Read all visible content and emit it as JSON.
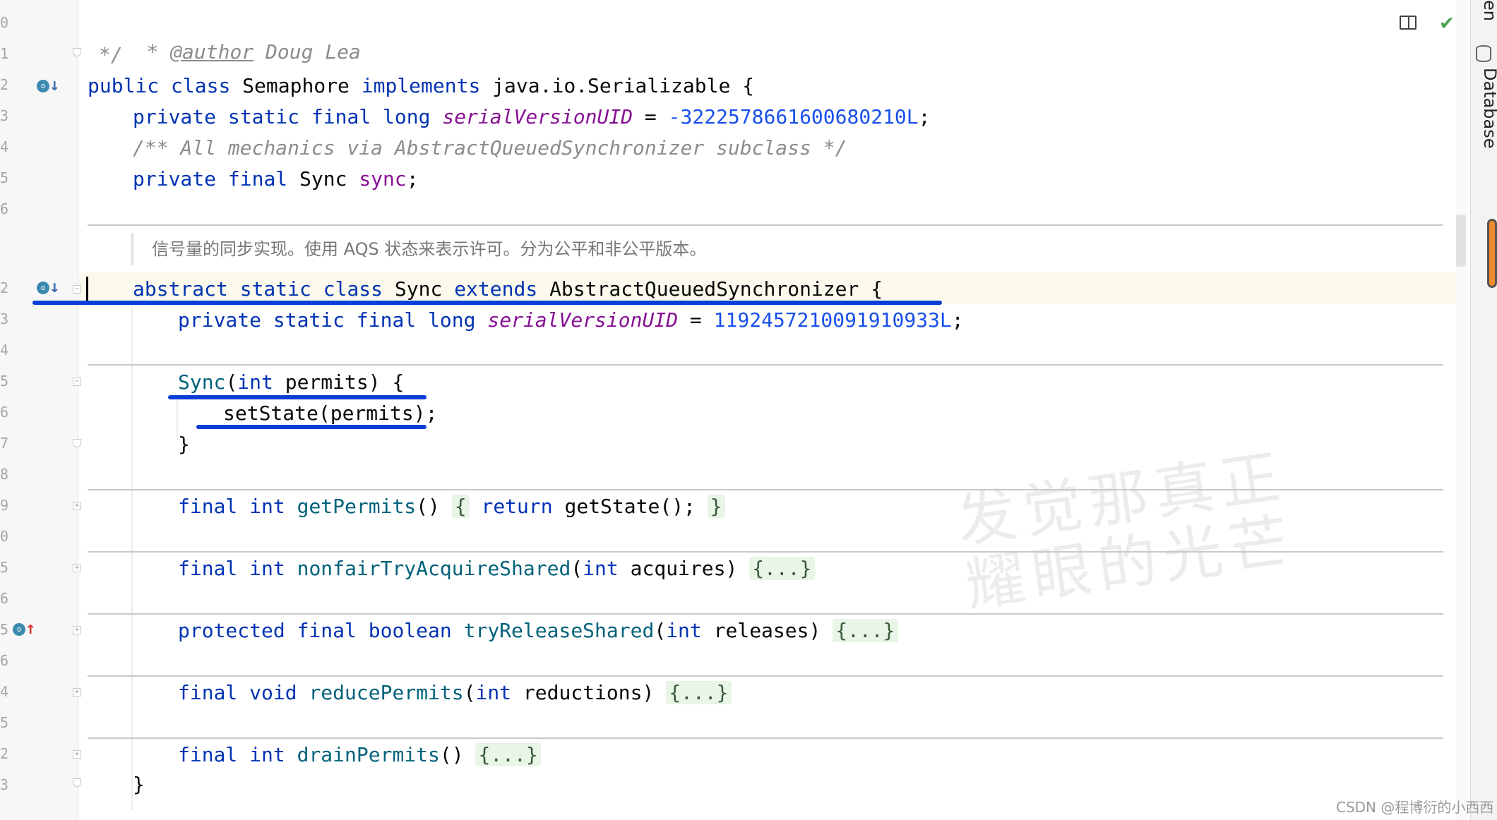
{
  "gutter": {
    "line_numbers": [
      "0",
      "1",
      "2",
      "3",
      "4",
      "5",
      "6",
      "2",
      "3",
      "4",
      "5",
      "6",
      "7",
      "8",
      "9",
      "0",
      "5",
      "6",
      "5",
      "6",
      "4",
      "5",
      "2",
      "3"
    ]
  },
  "code": {
    "l1": {
      "a": "* ",
      "b": "@author",
      "c": " Doug Lea"
    },
    "l2": "*/",
    "l3": {
      "k1": "public",
      "k2": "class",
      "name": "Semaphore",
      "k3": "implements",
      "rest": "java.io.Serializable {"
    },
    "l4": {
      "k1": "private",
      "k2": "static",
      "k3": "final",
      "k4": "long",
      "field": "serialVersionUID",
      "eq": " = ",
      "num": "-3222578661600680210L",
      "end": ";"
    },
    "l5": "/** All mechanics via AbstractQueuedSynchronizer subclass */",
    "l6": {
      "k1": "private",
      "k2": "final",
      "type": "Sync",
      "field": "sync",
      "end": ";"
    },
    "doc_note": "信号量的同步实现。使用 AQS 状态来表示许可。分为公平和非公平版本。",
    "l7": {
      "k1": "abstract",
      "k2": "static",
      "k3": "class",
      "name": "Sync",
      "k4": "extends",
      "rest": "AbstractQueuedSynchronizer {"
    },
    "l8": {
      "k1": "private",
      "k2": "static",
      "k3": "final",
      "k4": "long",
      "field": "serialVersionUID",
      "eq": " = ",
      "num": "1192457210091910933L",
      "end": ";"
    },
    "l9": {
      "fn": "Sync",
      "p1": "(",
      "kw": "int",
      "rest": " permits) {"
    },
    "l10": "setState(permits);",
    "l11": "}",
    "l12": {
      "k1": "final",
      "k2": "int",
      "fn": "getPermits",
      "p1": "() ",
      "chip1": "{",
      "k3": "return",
      "rest": " getState(); ",
      "chip2": "}"
    },
    "l13": {
      "k1": "final",
      "k2": "int",
      "fn": "nonfairTryAcquireShared",
      "p1": "(",
      "kw": "int",
      "rest": " acquires) ",
      "chip": "{...}"
    },
    "l14": {
      "k1": "protected",
      "k2": "final",
      "k3": "boolean",
      "fn": "tryReleaseShared",
      "p1": "(",
      "kw": "int",
      "rest": " releases) ",
      "chip": "{...}"
    },
    "l15": {
      "k1": "final",
      "k2": "void",
      "fn": "reducePermits",
      "p1": "(",
      "kw": "int",
      "rest": " reductions) ",
      "chip": "{...}"
    },
    "l16": {
      "k1": "final",
      "k2": "int",
      "fn": "drainPermits",
      "p1": "() ",
      "chip": "{...}"
    },
    "l17": "}"
  },
  "rail": {
    "top_label": "en",
    "database_label": "Database"
  },
  "watermark": {
    "line1": "发觉那真正",
    "line2": "耀眼的光芒"
  },
  "credit": "CSDN @程博衍的小西西",
  "colors": {
    "keyword": "#0033b3",
    "function": "#00627a",
    "field": "#871094",
    "number": "#1750eb",
    "comment": "#8c8c8c",
    "annotation_blue": "#0a3ed6"
  }
}
